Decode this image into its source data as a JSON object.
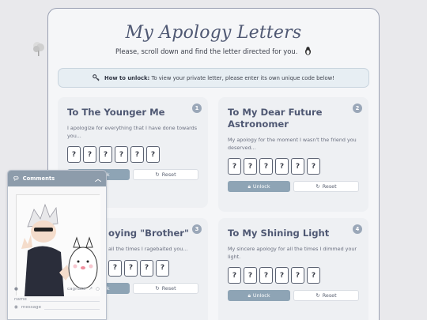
{
  "page": {
    "title": "My Apology Letters",
    "subtitle": "Please, scroll down and find the letter directed for you.",
    "unlock_hint": {
      "label": "How to unlock:",
      "text": "To view your private letter, please enter its own unique code below!"
    }
  },
  "letters": [
    {
      "num": "1",
      "title": "To The Younger Me",
      "desc": "I apologize for everything that I have done towards you...",
      "unlock": "Unlock",
      "reset": "Reset"
    },
    {
      "num": "2",
      "title": "To My Dear Future Astronomer",
      "desc": "My apology for the moment I wasn't the friend you deserved...",
      "unlock": "Unlock",
      "reset": "Reset"
    },
    {
      "num": "3",
      "title": "oying \"Brother\"",
      "desc": "all the times I ragebaited you...",
      "unlock": "Unlock",
      "reset": "Reset"
    },
    {
      "num": "4",
      "title": "To My Shining Light",
      "desc": "My sincere apology for all the times I dimmed your light.",
      "unlock": "Unlock",
      "reset": "Reset"
    }
  ],
  "code_placeholder": "?",
  "comments": {
    "header": "Comments",
    "name_placeholder": "name",
    "message_placeholder": "message",
    "cooltag": "cagnase"
  },
  "colors": {
    "accent": "#8ea4b5",
    "title": "#4f5873"
  }
}
